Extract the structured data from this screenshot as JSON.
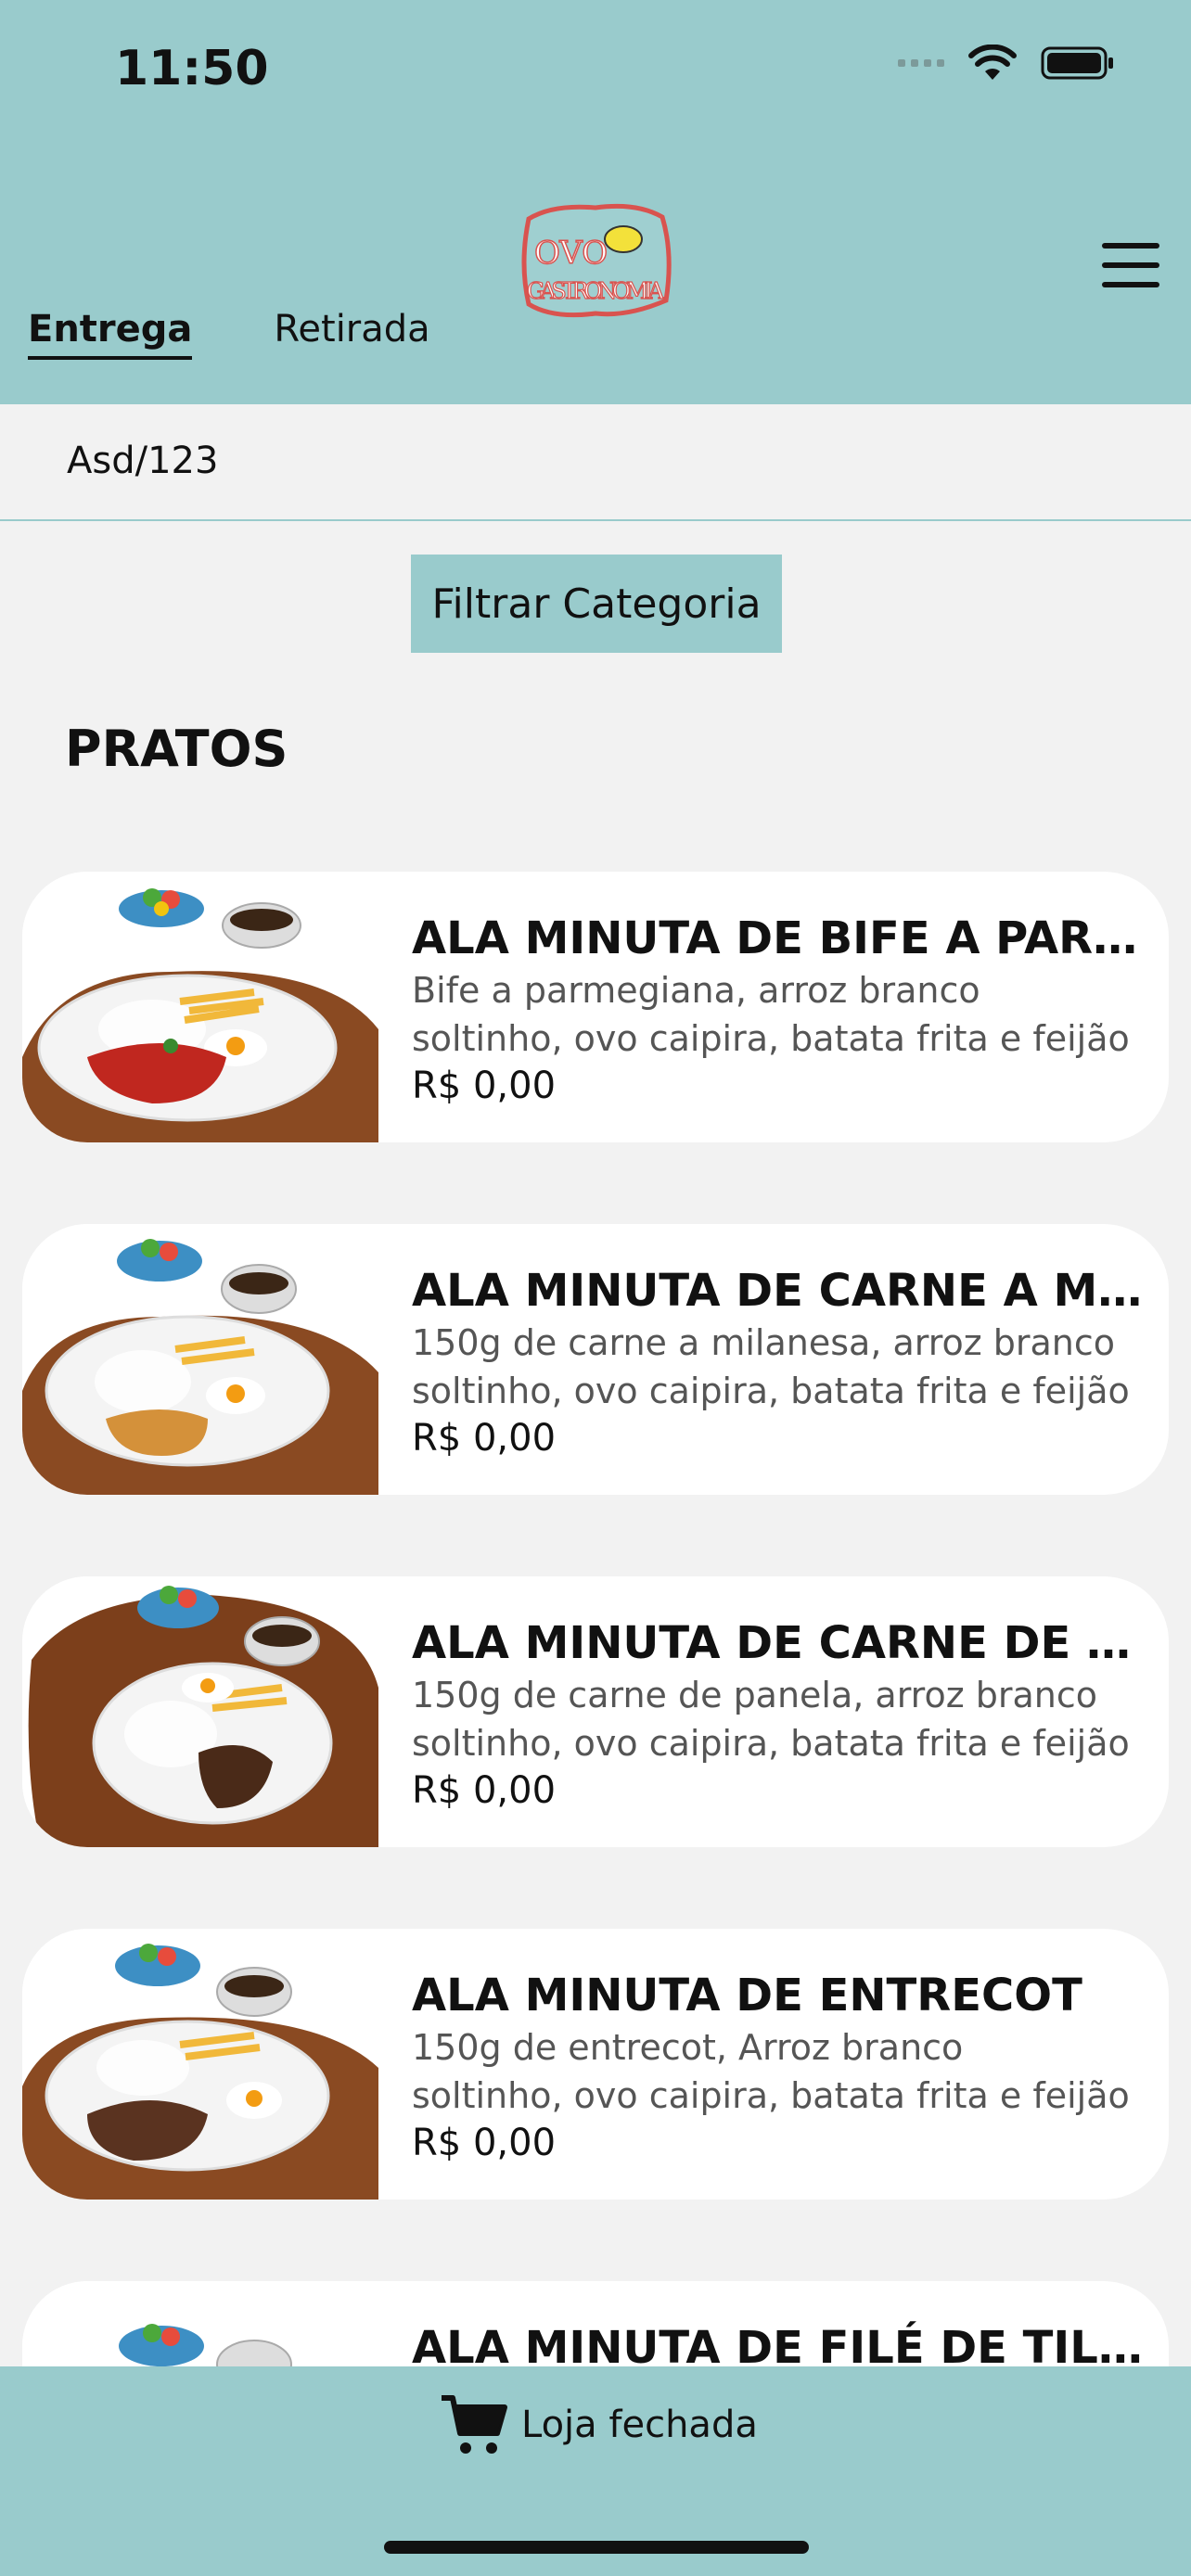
{
  "status_bar": {
    "time": "11:50"
  },
  "header": {
    "logo_text": "OVO GASTRONOMIA",
    "tabs": [
      {
        "label": "Entrega",
        "active": true
      },
      {
        "label": "Retirada",
        "active": false
      }
    ],
    "menu_icon": "hamburger-icon"
  },
  "address": {
    "text": "Asd/123"
  },
  "filter": {
    "label": "Filtrar Categoria"
  },
  "section": {
    "title": "PRATOS"
  },
  "products": [
    {
      "title": "ALA MINUTA DE BIFE A PARMEGIANA",
      "desc_line1": "Bife a parmegiana, arroz branco",
      "desc_line2": "soltinho, ovo caipira, batata frita e feijão",
      "price": "R$ 0,00"
    },
    {
      "title": "ALA MINUTA DE CARNE A MILANESA",
      "desc_line1": "150g de carne a milanesa, arroz branco",
      "desc_line2": "soltinho, ovo caipira, batata frita e feijão",
      "price": "R$ 0,00"
    },
    {
      "title": "ALA MINUTA DE CARNE DE PANELA",
      "desc_line1": "150g de carne de panela, arroz branco",
      "desc_line2": "soltinho, ovo caipira, batata frita e feijão",
      "price": "R$ 0,00"
    },
    {
      "title": "ALA MINUTA DE ENTRECOT",
      "desc_line1": "150g de entrecot, Arroz branco",
      "desc_line2": "soltinho, ovo caipira, batata frita e feijão",
      "price": "R$ 0,00"
    },
    {
      "title": "ALA MINUTA DE FILÉ DE TILÁPIA",
      "desc_line1": "",
      "desc_line2": "",
      "price": ""
    }
  ],
  "bottom_bar": {
    "cart_label": "Loja fechada",
    "cart_icon": "cart-icon"
  },
  "colors": {
    "primary": "#99cbcc",
    "background": "#f2f2f2",
    "card": "#ffffff",
    "logo_red": "#d9534f"
  }
}
